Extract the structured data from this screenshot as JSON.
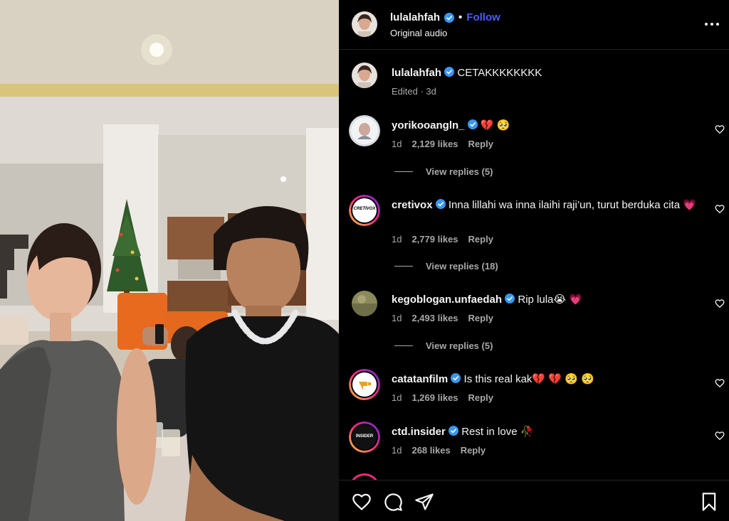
{
  "post": {
    "username": "lulalahfah",
    "separator": "•",
    "follow_label": "Follow",
    "audio": "Original audio"
  },
  "caption": {
    "username": "lulalahfah",
    "text": "CETAKKKKKKKK",
    "meta": "Edited · 3d"
  },
  "comments": [
    {
      "username": "yorikooangln_",
      "text": "💔 🥺",
      "age": "1d",
      "likes": "2,129 likes",
      "reply": "Reply",
      "view_replies": "View replies (5)"
    },
    {
      "username": "cretivox",
      "text": "Inna lillahi wa inna ilaihi raji’un, turut berduka cita 💗",
      "age": "1d",
      "likes": "2,779 likes",
      "reply": "Reply",
      "view_replies": "View replies (18)",
      "avatar_text": "CRETIVOX"
    },
    {
      "username": "kegoblogan.unfaedah",
      "text": "Rip lula😭 💗",
      "age": "1d",
      "likes": "2,493 likes",
      "reply": "Reply",
      "view_replies": "View replies (5)"
    },
    {
      "username": "catatanfilm",
      "text": "Is this real kak💔 💔 🥺 🥺",
      "age": "1d",
      "likes": "1,269 likes",
      "reply": "Reply"
    },
    {
      "username": "ctd.insider",
      "text": "Rest in love 🥀",
      "age": "1d",
      "likes": "268 likes",
      "reply": "Reply",
      "avatar_text": "INSIDER"
    }
  ],
  "icons": {
    "verified": "verified-badge-icon",
    "more": "more-options-icon",
    "like": "heart-icon",
    "comment": "comment-icon",
    "share": "share-icon",
    "save": "bookmark-icon"
  },
  "colors": {
    "accent": "#4a5df9",
    "verified": "#3897f0",
    "muted": "#a8a8a8",
    "background": "#000000"
  }
}
